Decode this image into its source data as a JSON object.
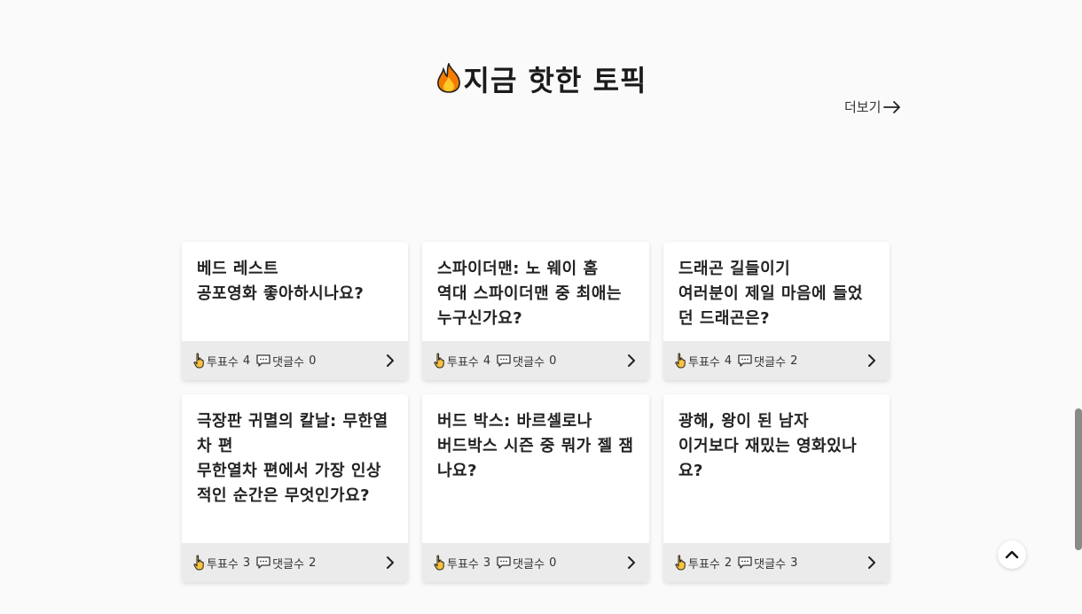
{
  "section": {
    "title": "지금 핫한 토픽",
    "title_icon": "fire-icon",
    "more_label": "더보기"
  },
  "cards": [
    {
      "movie": "베드 레스트",
      "question": "공포영화 좋아하시나요?",
      "vote_label": "투표수",
      "votes": "4",
      "comment_label": "댓글수",
      "comments": "0"
    },
    {
      "movie": "스파이더맨: 노 웨이 홈",
      "question": "역대 스파이더맨 중 최애는 누구신가요?",
      "vote_label": "투표수",
      "votes": "4",
      "comment_label": "댓글수",
      "comments": "0"
    },
    {
      "movie": "드래곤 길들이기",
      "question": "여러분이 제일 마음에 들었던 드래곤은?",
      "vote_label": "투표수",
      "votes": "4",
      "comment_label": "댓글수",
      "comments": "2"
    },
    {
      "movie": "극장판 귀멸의 칼날: 무한열차 편",
      "question": "무한열차 편에서 가장 인상적인 순간은 무엇인가요?",
      "vote_label": "투표수",
      "votes": "3",
      "comment_label": "댓글수",
      "comments": "2"
    },
    {
      "movie": "버드 박스: 바르셀로나",
      "question": "버드박스 시즌 중 뭐가 젤 잼나요?",
      "vote_label": "투표수",
      "votes": "3",
      "comment_label": "댓글수",
      "comments": "0"
    },
    {
      "movie": "광해, 왕이 된 남자",
      "question": "이거보다 재밌는 영화있나요?",
      "vote_label": "투표수",
      "votes": "2",
      "comment_label": "댓글수",
      "comments": "3"
    }
  ]
}
